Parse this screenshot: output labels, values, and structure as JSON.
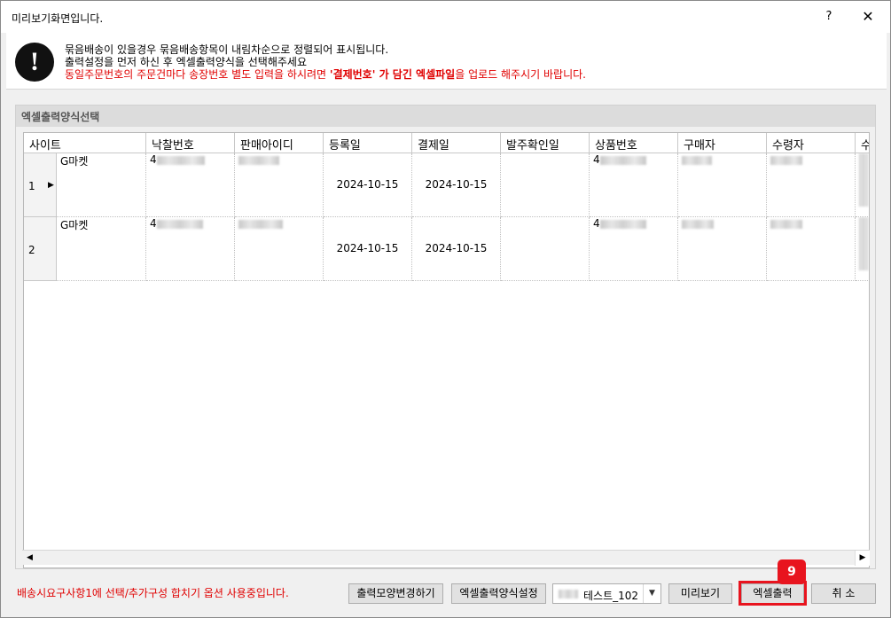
{
  "window": {
    "title": "미리보기화면입니다.",
    "help_label": "?",
    "close_label": "✕"
  },
  "notice": {
    "icon": "exclamation-icon",
    "line1": "묶음배송이 있을경우 묶음배송항목이 내림차순으로 정렬되어 표시됩니다.",
    "line2": "출력설정을 먼저 하신 후 엑셀출력양식을 선택해주세요",
    "line3_prefix": "동일주문번호의 주문건마다 송장번호 별도 입력을 하시려면 ",
    "line3_bold": "'결제번호' 가 담긴 엑셀파일",
    "line3_suffix": "을 업로드 해주시기 바랍니다."
  },
  "group": {
    "title": "엑셀출력양식선택"
  },
  "grid": {
    "columns": [
      "사이트",
      "낙찰번호",
      "판매아이디",
      "등록일",
      "결제일",
      "발주확인일",
      "상품번호",
      "구매자",
      "수령자",
      "수"
    ],
    "rows": [
      {
        "num": "1",
        "selected": true,
        "site": "G마켓",
        "bid_no": "4",
        "register_date": "2024-10-15",
        "payment_date": "2024-10-15",
        "product_no": "4"
      },
      {
        "num": "2",
        "selected": false,
        "site": "G마켓",
        "bid_no": "4",
        "register_date": "2024-10-15",
        "payment_date": "2024-10-15",
        "product_no": "4"
      }
    ]
  },
  "footer": {
    "message": "배송시요구사항1에 선택/추가구성 합치기 옵션 사용중입니다.",
    "btn_change_shape": "출력모양변경하기",
    "btn_excel_format_setting": "엑셀출력양식설정",
    "select_value": "테스트_102",
    "btn_preview": "미리보기",
    "btn_excel_export": "엑셀출력",
    "btn_cancel": "취 소",
    "step_badge": "9"
  },
  "colors": {
    "highlight": "#e8141e",
    "warning_text": "#e00000"
  }
}
